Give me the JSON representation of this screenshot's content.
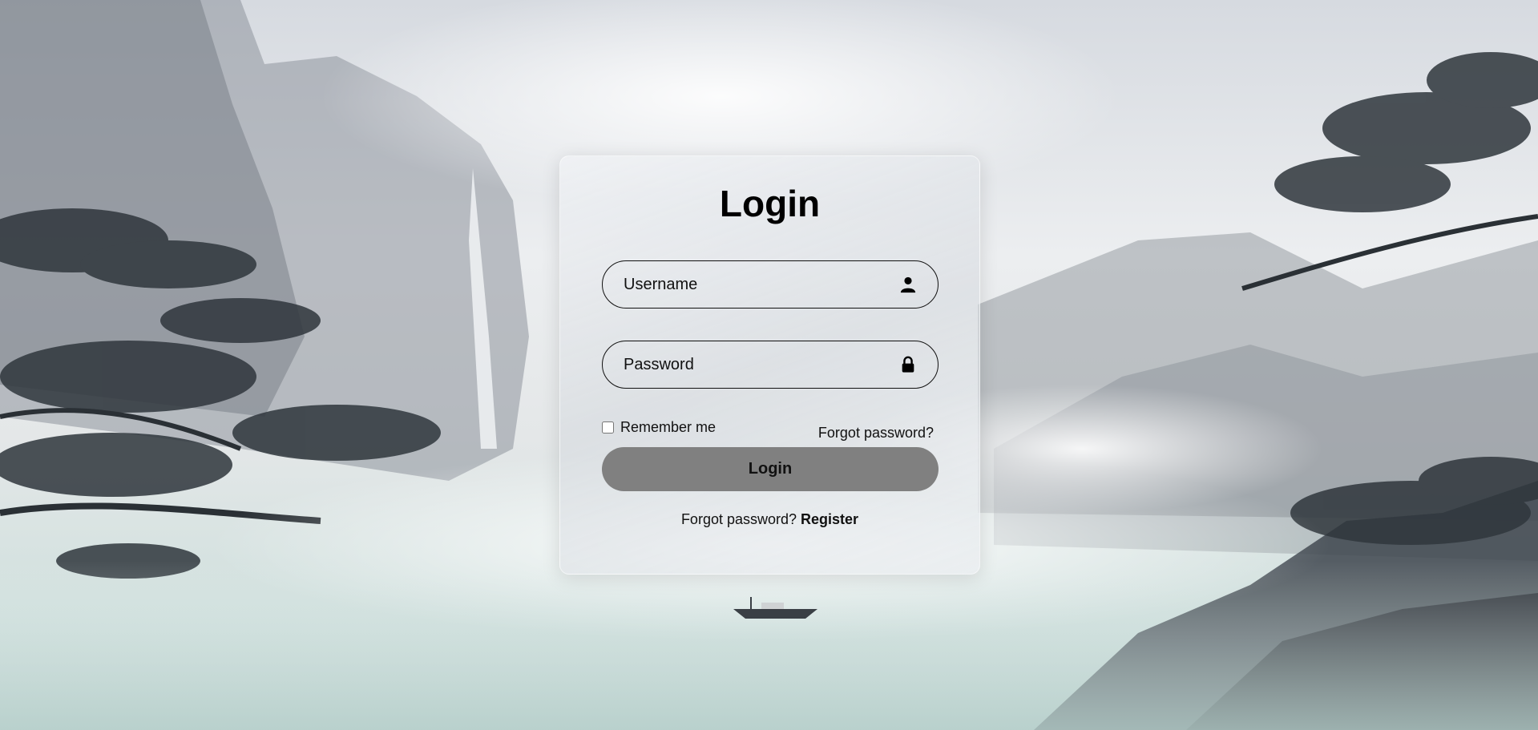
{
  "login_form": {
    "title": "Login",
    "username_placeholder": "Username",
    "password_placeholder": "Password",
    "username_icon": "user-icon",
    "password_icon": "lock-icon",
    "remember_label": "Remember me",
    "remember_checked": false,
    "forgot_link": "Forgot password?",
    "submit_label": "Login",
    "footer_prefix": "Forgot password?",
    "register_link": "Register"
  },
  "colors": {
    "button": "#808080",
    "text": "#111111"
  }
}
